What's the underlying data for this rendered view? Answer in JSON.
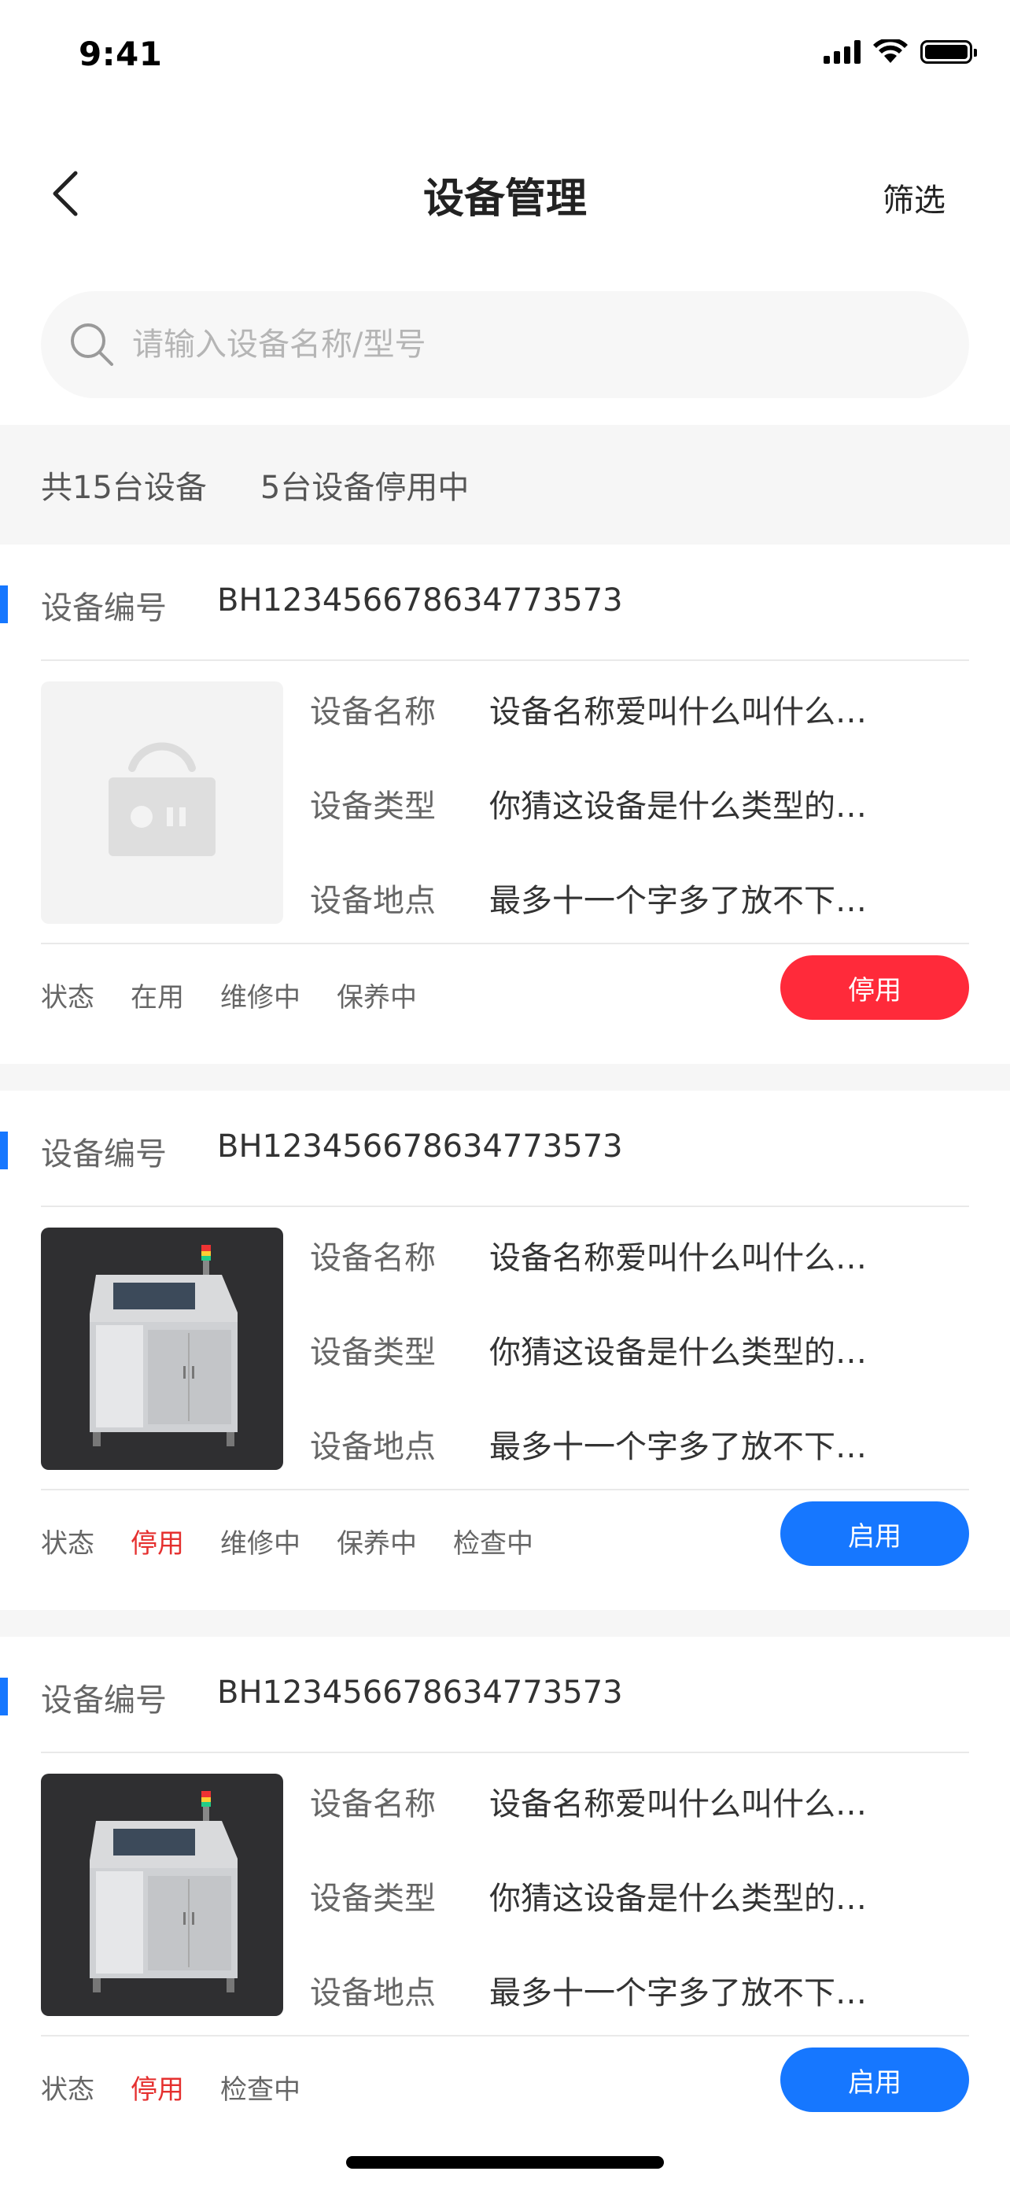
{
  "status_bar": {
    "time": "9:41"
  },
  "nav": {
    "title": "设备管理",
    "filter_label": "筛选"
  },
  "search": {
    "placeholder": "请输入设备名称/型号"
  },
  "summary": {
    "total": "共15台设备",
    "disabled": "5台设备停用中"
  },
  "labels": {
    "device_no": "设备编号",
    "name": "设备名称",
    "type": "设备类型",
    "location": "设备地点",
    "status": "状态"
  },
  "devices": [
    {
      "device_no": "BH123456678634773573",
      "name": "设备名称爱叫什么叫什么…",
      "type": "你猜这设备是什么类型的…",
      "location": "最多十一个字多了放不下…",
      "image": "placeholder-device-icon",
      "tags": [
        "在用",
        "维修中",
        "保养中"
      ],
      "action": "停用",
      "action_color": "#ff2a3a"
    },
    {
      "device_no": "BH123456678634773573",
      "name": "设备名称爱叫什么叫什么…",
      "type": "你猜这设备是什么类型的…",
      "location": "最多十一个字多了放不下…",
      "image": "machine-photo",
      "tags": [
        "停用",
        "维修中",
        "保养中",
        "检查中"
      ],
      "action": "启用",
      "action_color": "#1677ff"
    },
    {
      "device_no": "BH123456678634773573",
      "name": "设备名称爱叫什么叫什么…",
      "type": "你猜这设备是什么类型的…",
      "location": "最多十一个字多了放不下…",
      "image": "machine-photo",
      "tags": [
        "停用",
        "检查中"
      ],
      "action": "启用",
      "action_color": "#1677ff"
    }
  ],
  "colors": {
    "accent_blue": "#1677ff",
    "danger_red": "#ff2a3a",
    "tag_red": "#e5302f"
  }
}
